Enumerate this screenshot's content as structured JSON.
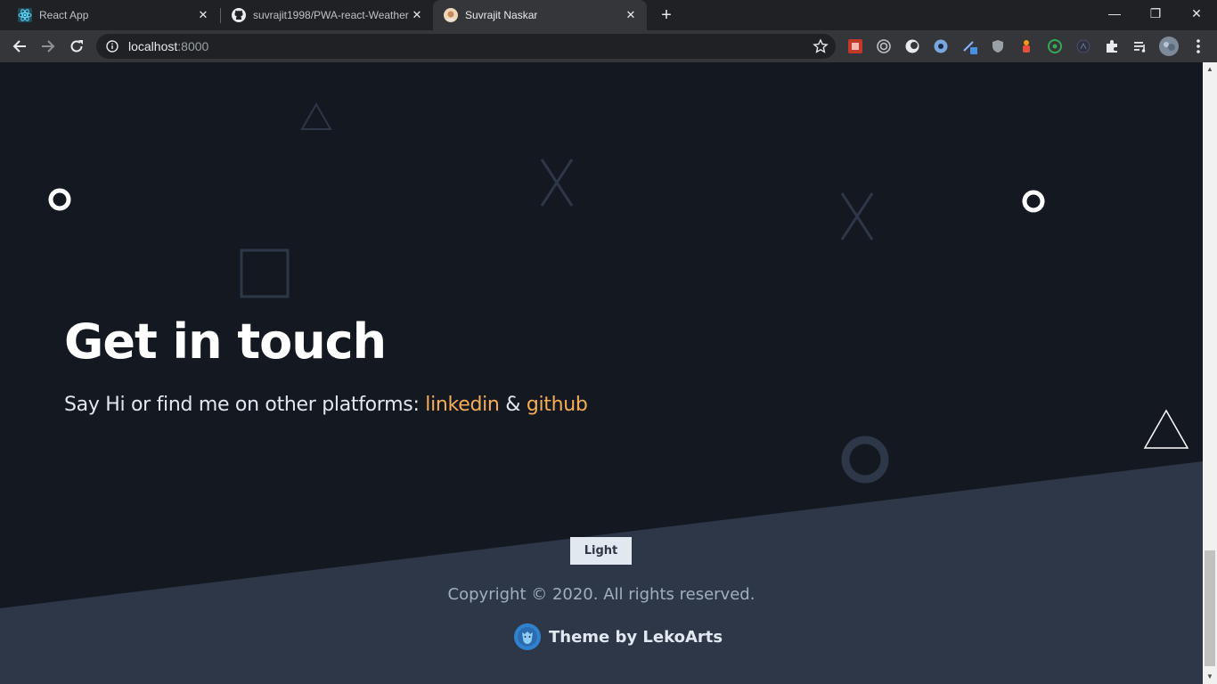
{
  "browser": {
    "tabs": [
      {
        "title": "React App",
        "favicon": "react-icon",
        "active": false
      },
      {
        "title": "suvrajit1998/PWA-react-Weather",
        "favicon": "github-icon",
        "active": false
      },
      {
        "title": "Suvrajit Naskar",
        "favicon": "avatar-icon",
        "active": true
      }
    ],
    "close_glyph": "✕",
    "new_tab_glyph": "+",
    "window_controls": {
      "minimize": "—",
      "restore": "❐",
      "close": "✕"
    },
    "address": {
      "host": "localhost",
      "port": ":8000"
    },
    "extensions": [
      "red-extension-icon",
      "target-extension-icon",
      "moon-extension-icon",
      "blue-circle-extension-icon",
      "pen-extension-icon",
      "shield-extension-icon",
      "figure-extension-icon",
      "whatsapp-extension-icon",
      "dark-circle-extension-icon",
      "puzzle-icon",
      "playlist-icon",
      "profile-avatar-icon",
      "menu-dots-icon"
    ]
  },
  "page": {
    "heading": "Get in touch",
    "subline_prefix": "Say Hi or find me on other platforms: ",
    "link_linkedin": "linkedin",
    "amp": " & ",
    "link_github": "github",
    "mode_button": "Light",
    "copyright": "Copyright © 2020. All rights reserved.",
    "credit": "Theme by LekoArts",
    "colors": {
      "background": "#141821",
      "footer": "#2d3748",
      "accent": "#f6ad55",
      "text": "#e2e8f0",
      "muted": "#a0aec0"
    }
  },
  "scrollbar": {
    "up": "▲",
    "down": "▼"
  }
}
